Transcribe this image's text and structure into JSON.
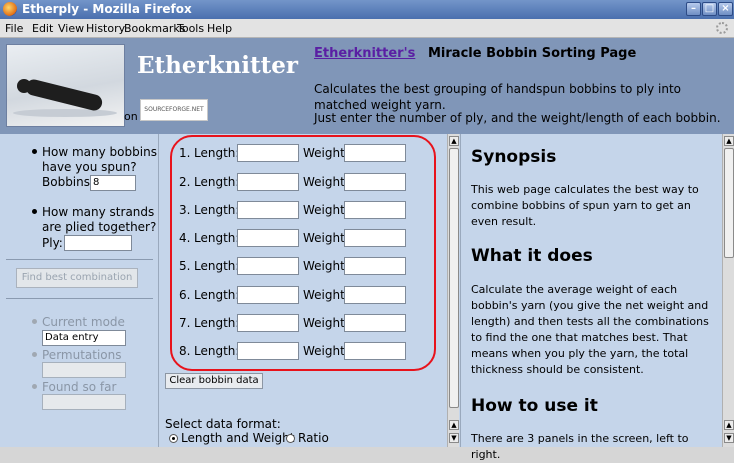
{
  "window": {
    "title": "Etherply - Mozilla Firefox"
  },
  "menu": [
    "File",
    "Edit",
    "View",
    "History",
    "Bookmarks",
    "Tools",
    "Help"
  ],
  "header": {
    "brand": "Etherknitter",
    "on_text": "on",
    "sourceforge_logo": "SOURCEFORGE.NET",
    "site_link": "Etherknitter's",
    "site_title_rest": "Miracle Bobbin Sorting Page",
    "description_line1": "Calculates the best grouping of handspun bobbins to ply into matched weight yarn.",
    "description_line2": "Just enter the number of ply, and the weight/length of each bobbin."
  },
  "left_panel": {
    "q1_line1": "How many bobbins",
    "q1_line2": "have you spun?",
    "bobbins_label": "Bobbins:",
    "bobbins_value": "8",
    "q2_line1": "How many strands",
    "q2_line2": "are plied together?",
    "ply_label": "Ply:",
    "ply_value": "",
    "find_button": "Find best combination",
    "current_mode_label": "Current mode",
    "current_mode_value": "Data entry",
    "permutations_label": "Permutations",
    "found_so_far_label": "Found so far"
  },
  "middle_panel": {
    "length_label": "Length:",
    "weight_label": "Weight:",
    "rows": [
      "1.",
      "2.",
      "3.",
      "4.",
      "5.",
      "6.",
      "7.",
      "8."
    ],
    "clear_button": "Clear bobbin data",
    "format_label": "Select data format:",
    "format_options": [
      "Length and Weight",
      "Ratio"
    ],
    "format_selected": "Length and Weight"
  },
  "right_panel": {
    "synopsis_heading": "Synopsis",
    "synopsis_text": "This web page calculates the best way to combine bobbins of spun yarn to get an even result.",
    "what_heading": "What it does",
    "what_text": "Calculate the average weight of each bobbin's yarn (you give the net weight and length) and then tests all the combinations to find the one that matches best. That means when you ply the yarn, the total thickness should be consistent.",
    "how_heading": "How to use it",
    "how_text": "There are 3 panels in the screen, left to right."
  },
  "colors": {
    "header_bg": "#8096b8",
    "panel_bg": "#c5d5ea",
    "highlight_circle": "#e8121b",
    "link": "#5a1fa3"
  }
}
